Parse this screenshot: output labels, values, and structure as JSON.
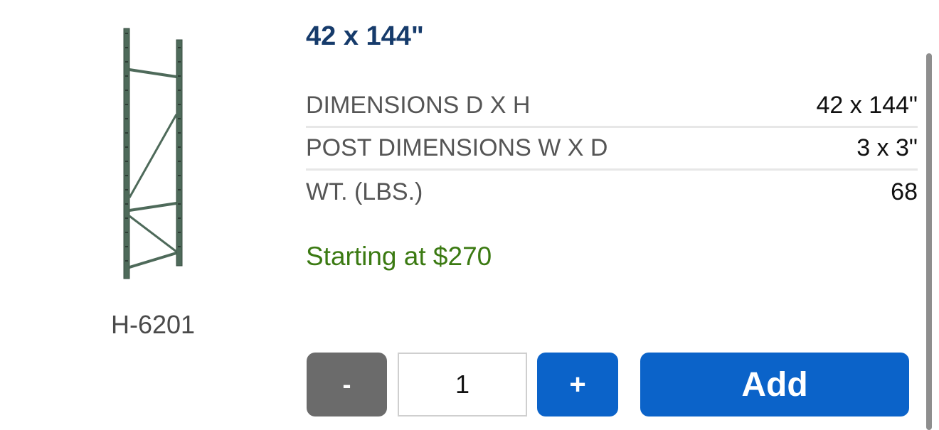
{
  "product": {
    "sku": "H-6201",
    "title": "42 x 144\"",
    "image_icon": "pallet-rack-upright-frame"
  },
  "specs": [
    {
      "label": "DIMENSIONS D X H",
      "value": "42 x 144\""
    },
    {
      "label": "POST DIMENSIONS W X D",
      "value": "3 x 3\""
    },
    {
      "label": "WT. (LBS.)",
      "value": "68"
    }
  ],
  "price": {
    "text": "Starting at $270",
    "color": "#3b7a12"
  },
  "cart": {
    "minus_label": "-",
    "quantity": "1",
    "plus_label": "+",
    "add_label": "Add",
    "accent_color": "#0b63c9",
    "minus_color": "#6b6b6b"
  }
}
